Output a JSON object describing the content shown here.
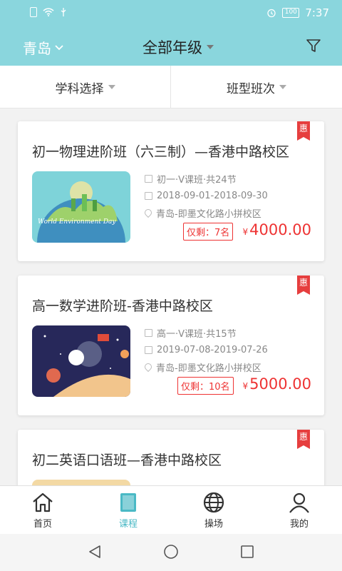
{
  "status": {
    "time": "7:37",
    "battery": "100"
  },
  "nav": {
    "city": "青岛",
    "grade": "全部年级"
  },
  "tabs": {
    "subject": "学科选择",
    "class_type": "班型班次"
  },
  "courses": [
    {
      "title": "初一物理进阶班（六三制）—香港中路校区",
      "badge": "惠",
      "type": "初一·V课班·共24节",
      "dates": "2018-09-01-2018-09-30",
      "location": "青岛-即墨文化路小拼校区",
      "remain": "仅剩：7名",
      "price": "4000.00",
      "currency": "¥",
      "image_text": "World Environment Day"
    },
    {
      "title": "高一数学进阶班-香港中路校区",
      "badge": "惠",
      "type": "高一·V课班·共15节",
      "dates": "2019-07-08-2019-07-26",
      "location": "青岛-即墨文化路小拼校区",
      "remain": "仅剩：10名",
      "price": "5000.00",
      "currency": "¥"
    },
    {
      "title": "初二英语口语班—香港中路校区",
      "badge": "惠"
    }
  ],
  "tabbar": [
    {
      "label": "首页",
      "icon": "home-icon"
    },
    {
      "label": "课程",
      "icon": "book-icon"
    },
    {
      "label": "操场",
      "icon": "globe-icon"
    },
    {
      "label": "我的",
      "icon": "user-icon"
    }
  ],
  "colors": {
    "header": "#8ad6dd",
    "accent": "#4ab9c5",
    "price": "#e33333"
  }
}
